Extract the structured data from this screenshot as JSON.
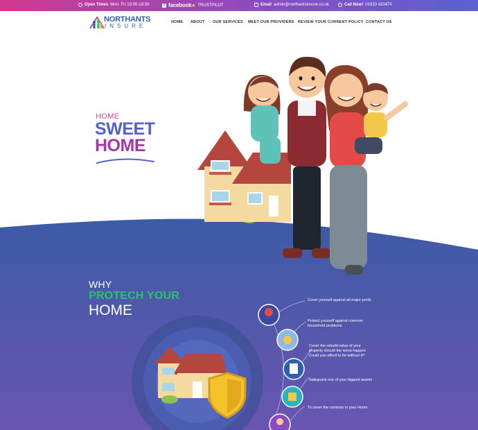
{
  "topbar": {
    "open_label": "Open Times",
    "open_value": "Mon- Fri 10:00-18:30",
    "facebook": "facebook",
    "trustpilot": "TRUSTPILOT",
    "email_label": "Email",
    "email_value": "admin@northantsinsure.co.uk",
    "call_label": "Call Now!",
    "call_value": "01933 420470",
    "colors": {
      "start": "#d2398e",
      "end": "#5a62d2"
    }
  },
  "logo": {
    "top": "NORTHANTS",
    "bottom": "INSURE"
  },
  "nav": {
    "items": [
      "HOME",
      "ABOUT",
      "OUR SERVICES",
      "MEET OUR PROVIDERS",
      "REVIEW YOUR CURRENT POLICY",
      "CONTACT US"
    ],
    "active_index": 2
  },
  "hero": {
    "line1": "HOME",
    "line2": "SWEET",
    "line3": "HOME"
  },
  "why": {
    "line1": "WHY",
    "line2": "PROTECH YOUR",
    "line3": "HOME"
  },
  "features": [
    {
      "text": "Cover yourself against all major perils",
      "icon": "burglar-icon"
    },
    {
      "text": "Protect yourself against common\nhousehold problems",
      "icon": "hands-heart-icon"
    },
    {
      "text": "Cover the rebuild value of your\nproperty should the worst happen\nCould you afford to be without it?",
      "icon": "document-icon"
    },
    {
      "text": "Safeguard one of your biggest assets",
      "icon": "house-shield-icon"
    },
    {
      "text": "To cover the contents in your  Home",
      "icon": "family-icon"
    }
  ],
  "colors": {
    "section_bg_top": "#3f5aa6",
    "section_bg_bottom": "#6a55b0",
    "accent_green": "#27c468",
    "accent_pink": "#e0458a",
    "accent_blue": "#5561c9",
    "accent_purple": "#a536a7"
  }
}
